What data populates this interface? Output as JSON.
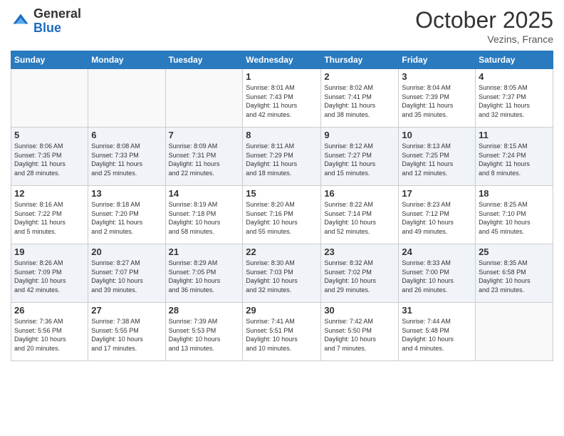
{
  "header": {
    "logo_general": "General",
    "logo_blue": "Blue",
    "month_title": "October 2025",
    "location": "Vezins, France"
  },
  "days_of_week": [
    "Sunday",
    "Monday",
    "Tuesday",
    "Wednesday",
    "Thursday",
    "Friday",
    "Saturday"
  ],
  "weeks": [
    [
      {
        "day": "",
        "info": ""
      },
      {
        "day": "",
        "info": ""
      },
      {
        "day": "",
        "info": ""
      },
      {
        "day": "1",
        "info": "Sunrise: 8:01 AM\nSunset: 7:43 PM\nDaylight: 11 hours\nand 42 minutes."
      },
      {
        "day": "2",
        "info": "Sunrise: 8:02 AM\nSunset: 7:41 PM\nDaylight: 11 hours\nand 38 minutes."
      },
      {
        "day": "3",
        "info": "Sunrise: 8:04 AM\nSunset: 7:39 PM\nDaylight: 11 hours\nand 35 minutes."
      },
      {
        "day": "4",
        "info": "Sunrise: 8:05 AM\nSunset: 7:37 PM\nDaylight: 11 hours\nand 32 minutes."
      }
    ],
    [
      {
        "day": "5",
        "info": "Sunrise: 8:06 AM\nSunset: 7:35 PM\nDaylight: 11 hours\nand 28 minutes."
      },
      {
        "day": "6",
        "info": "Sunrise: 8:08 AM\nSunset: 7:33 PM\nDaylight: 11 hours\nand 25 minutes."
      },
      {
        "day": "7",
        "info": "Sunrise: 8:09 AM\nSunset: 7:31 PM\nDaylight: 11 hours\nand 22 minutes."
      },
      {
        "day": "8",
        "info": "Sunrise: 8:11 AM\nSunset: 7:29 PM\nDaylight: 11 hours\nand 18 minutes."
      },
      {
        "day": "9",
        "info": "Sunrise: 8:12 AM\nSunset: 7:27 PM\nDaylight: 11 hours\nand 15 minutes."
      },
      {
        "day": "10",
        "info": "Sunrise: 8:13 AM\nSunset: 7:25 PM\nDaylight: 11 hours\nand 12 minutes."
      },
      {
        "day": "11",
        "info": "Sunrise: 8:15 AM\nSunset: 7:24 PM\nDaylight: 11 hours\nand 8 minutes."
      }
    ],
    [
      {
        "day": "12",
        "info": "Sunrise: 8:16 AM\nSunset: 7:22 PM\nDaylight: 11 hours\nand 5 minutes."
      },
      {
        "day": "13",
        "info": "Sunrise: 8:18 AM\nSunset: 7:20 PM\nDaylight: 11 hours\nand 2 minutes."
      },
      {
        "day": "14",
        "info": "Sunrise: 8:19 AM\nSunset: 7:18 PM\nDaylight: 10 hours\nand 58 minutes."
      },
      {
        "day": "15",
        "info": "Sunrise: 8:20 AM\nSunset: 7:16 PM\nDaylight: 10 hours\nand 55 minutes."
      },
      {
        "day": "16",
        "info": "Sunrise: 8:22 AM\nSunset: 7:14 PM\nDaylight: 10 hours\nand 52 minutes."
      },
      {
        "day": "17",
        "info": "Sunrise: 8:23 AM\nSunset: 7:12 PM\nDaylight: 10 hours\nand 49 minutes."
      },
      {
        "day": "18",
        "info": "Sunrise: 8:25 AM\nSunset: 7:10 PM\nDaylight: 10 hours\nand 45 minutes."
      }
    ],
    [
      {
        "day": "19",
        "info": "Sunrise: 8:26 AM\nSunset: 7:09 PM\nDaylight: 10 hours\nand 42 minutes."
      },
      {
        "day": "20",
        "info": "Sunrise: 8:27 AM\nSunset: 7:07 PM\nDaylight: 10 hours\nand 39 minutes."
      },
      {
        "day": "21",
        "info": "Sunrise: 8:29 AM\nSunset: 7:05 PM\nDaylight: 10 hours\nand 36 minutes."
      },
      {
        "day": "22",
        "info": "Sunrise: 8:30 AM\nSunset: 7:03 PM\nDaylight: 10 hours\nand 32 minutes."
      },
      {
        "day": "23",
        "info": "Sunrise: 8:32 AM\nSunset: 7:02 PM\nDaylight: 10 hours\nand 29 minutes."
      },
      {
        "day": "24",
        "info": "Sunrise: 8:33 AM\nSunset: 7:00 PM\nDaylight: 10 hours\nand 26 minutes."
      },
      {
        "day": "25",
        "info": "Sunrise: 8:35 AM\nSunset: 6:58 PM\nDaylight: 10 hours\nand 23 minutes."
      }
    ],
    [
      {
        "day": "26",
        "info": "Sunrise: 7:36 AM\nSunset: 5:56 PM\nDaylight: 10 hours\nand 20 minutes."
      },
      {
        "day": "27",
        "info": "Sunrise: 7:38 AM\nSunset: 5:55 PM\nDaylight: 10 hours\nand 17 minutes."
      },
      {
        "day": "28",
        "info": "Sunrise: 7:39 AM\nSunset: 5:53 PM\nDaylight: 10 hours\nand 13 minutes."
      },
      {
        "day": "29",
        "info": "Sunrise: 7:41 AM\nSunset: 5:51 PM\nDaylight: 10 hours\nand 10 minutes."
      },
      {
        "day": "30",
        "info": "Sunrise: 7:42 AM\nSunset: 5:50 PM\nDaylight: 10 hours\nand 7 minutes."
      },
      {
        "day": "31",
        "info": "Sunrise: 7:44 AM\nSunset: 5:48 PM\nDaylight: 10 hours\nand 4 minutes."
      },
      {
        "day": "",
        "info": ""
      }
    ]
  ]
}
